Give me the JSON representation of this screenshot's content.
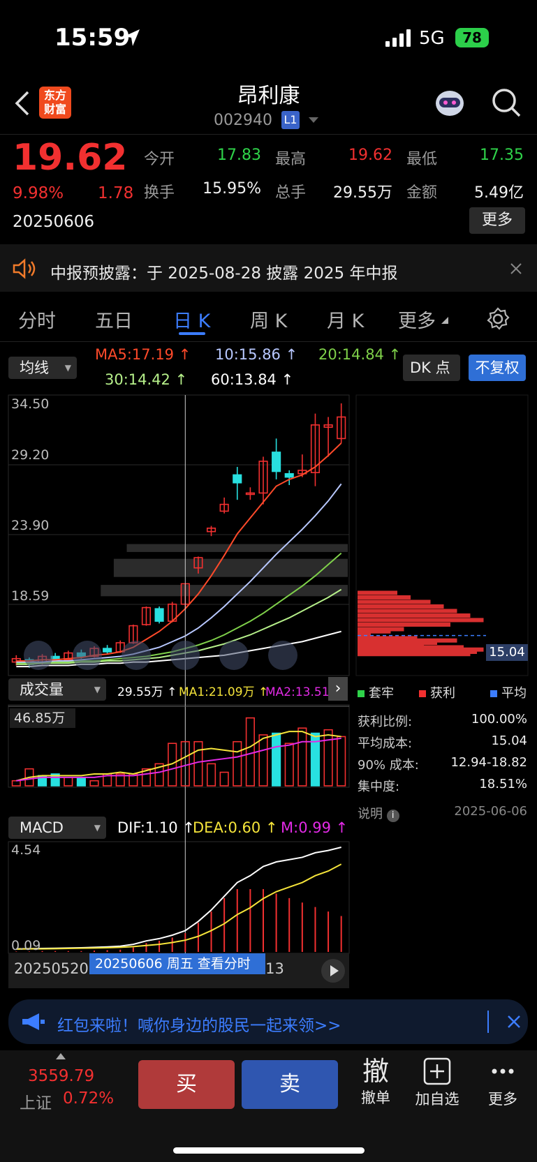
{
  "status_bar": {
    "time": "15:59",
    "network": "5G",
    "battery": "78"
  },
  "header": {
    "title": "昂利康",
    "code": "002940",
    "level_badge": "L1",
    "logo_line1": "东方",
    "logo_line2": "财富"
  },
  "quote": {
    "price": "19.62",
    "change_pct": "9.98%",
    "change": "1.78",
    "date": "20250606",
    "open_label": "今开",
    "open": "17.83",
    "high_label": "最高",
    "high": "19.62",
    "low_label": "最低",
    "low": "17.35",
    "turnover_label": "换手",
    "turnover": "15.95%",
    "volume_label": "总手",
    "volume": "29.55万",
    "amount_label": "金额",
    "amount": "5.49亿",
    "more_label": "更多"
  },
  "notice": {
    "text": "中报预披露：于 2025-08-28 披露 2025 年中报"
  },
  "tabs": [
    "分时",
    "五日",
    "日 K",
    "周 K",
    "月 K",
    "更多"
  ],
  "active_tab": "日 K",
  "kline": {
    "indicator_select": "均线",
    "ma5": "MA5:17.19 ↑",
    "ma10": "10:15.86 ↑",
    "ma20": "20:14.84 ↑",
    "ma30": "30:14.42 ↑",
    "ma60": "60:13.84 ↑",
    "dk_label": "DK 点",
    "fq_label": "不复权",
    "y_ticks": [
      "34.50",
      "29.20",
      "23.90",
      "18.59"
    ]
  },
  "volume_panel": {
    "select": "成交量",
    "vol": "29.55万 ↑",
    "ma1": "MA1:21.09万 ↑",
    "ma2": "MA2:13.51万",
    "max_label": "46.85万"
  },
  "macd_panel": {
    "select": "MACD",
    "dif": "DIF:1.10 ↑",
    "dea": "DEA:0.60 ↑",
    "m": "M:0.99 ↑",
    "y_top": "4.54",
    "y_bottom": "0.09",
    "date_start": "20250520",
    "date_mid": "20250613",
    "crosshair_label": "20250606 周五 查看分时"
  },
  "chip_profile": {
    "current_cost_label": "15.04",
    "legend": [
      "套牢",
      "获利",
      "平均"
    ],
    "profit_ratio_label": "获利比例:",
    "profit_ratio": "100.00%",
    "avg_cost_label": "平均成本:",
    "avg_cost": "15.04",
    "cost90_label": "90% 成本:",
    "cost90": "12.94-18.82",
    "concentration_label": "集中度:",
    "concentration": "18.51%",
    "note_label": "说明",
    "date": "2025-06-06"
  },
  "redpack": {
    "text": "红包来啦！喊你身边的股民一起来领>>"
  },
  "bottom_bar": {
    "index_value": "3559.79",
    "index_name": "上证",
    "index_change": "0.72%",
    "buy": "买",
    "sell": "卖",
    "cancel_icon": "撤",
    "cancel": "撤单",
    "add": "加自选",
    "more": "更多"
  },
  "colors": {
    "up": "#f23030",
    "down": "#2fd34a",
    "accent": "#3c7dff",
    "ma5": "#ff4a2a",
    "ma10": "#b8c8ff",
    "ma20": "#7fd14a",
    "ma30": "#b6f08a",
    "ma60": "#ffffff"
  },
  "chart_data": [
    {
      "type": "candlestick",
      "title": "",
      "ylim": [
        12.0,
        35.5
      ],
      "candles": [
        {
          "o": 12.7,
          "c": 13.0,
          "h": 13.3,
          "l": 12.4
        },
        {
          "o": 12.9,
          "c": 12.5,
          "h": 13.1,
          "l": 12.2
        },
        {
          "o": 12.6,
          "c": 13.2,
          "h": 13.4,
          "l": 12.5
        },
        {
          "o": 13.2,
          "c": 12.9,
          "h": 13.5,
          "l": 12.7
        },
        {
          "o": 12.9,
          "c": 13.5,
          "h": 13.7,
          "l": 12.8
        },
        {
          "o": 13.5,
          "c": 13.2,
          "h": 13.8,
          "l": 13.0
        },
        {
          "o": 13.2,
          "c": 13.9,
          "h": 14.1,
          "l": 13.1
        },
        {
          "o": 13.9,
          "c": 13.6,
          "h": 14.2,
          "l": 13.4
        },
        {
          "o": 13.6,
          "c": 14.4,
          "h": 14.6,
          "l": 13.5
        },
        {
          "o": 14.4,
          "c": 15.9,
          "h": 16.0,
          "l": 14.3
        },
        {
          "o": 16.0,
          "c": 17.5,
          "h": 17.6,
          "l": 15.9
        },
        {
          "o": 17.4,
          "c": 16.3,
          "h": 17.6,
          "l": 16.1
        },
        {
          "o": 16.3,
          "c": 17.8,
          "h": 18.0,
          "l": 16.2
        },
        {
          "o": 17.8,
          "c": 19.6,
          "h": 19.6,
          "l": 17.4
        },
        {
          "o": 21.0,
          "c": 21.9,
          "h": 22.0,
          "l": 20.5
        },
        {
          "o": 24.2,
          "c": 24.5,
          "h": 24.7,
          "l": 23.8
        },
        {
          "o": 26.0,
          "c": 26.6,
          "h": 27.2,
          "l": 25.8
        },
        {
          "o": 29.2,
          "c": 28.5,
          "h": 29.9,
          "l": 27.0
        },
        {
          "o": 27.5,
          "c": 27.6,
          "h": 28.1,
          "l": 27.0
        },
        {
          "o": 27.6,
          "c": 30.4,
          "h": 30.8,
          "l": 26.6
        },
        {
          "o": 31.2,
          "c": 29.5,
          "h": 32.4,
          "l": 28.8
        },
        {
          "o": 29.3,
          "c": 29.0,
          "h": 29.6,
          "l": 28.3
        },
        {
          "o": 29.3,
          "c": 29.6,
          "h": 31.0,
          "l": 29.0
        },
        {
          "o": 29.4,
          "c": 33.6,
          "h": 34.6,
          "l": 28.2
        },
        {
          "o": 33.4,
          "c": 33.6,
          "h": 34.3,
          "l": 30.8
        },
        {
          "o": 32.4,
          "c": 34.3,
          "h": 35.5,
          "l": 32.0
        }
      ],
      "ma5": [
        12.8,
        12.8,
        12.9,
        12.9,
        13.0,
        13.1,
        13.3,
        13.4,
        13.6,
        14.0,
        14.7,
        15.4,
        16.3,
        17.4,
        18.7,
        20.3,
        22.1,
        24.0,
        25.4,
        26.8,
        28.2,
        28.8,
        29.2,
        29.9,
        30.9,
        32.0
      ],
      "ma10": [
        12.7,
        12.7,
        12.7,
        12.8,
        12.8,
        12.9,
        13.0,
        13.1,
        13.2,
        13.4,
        13.7,
        14.0,
        14.5,
        15.0,
        15.7,
        16.6,
        17.6,
        18.7,
        19.8,
        21.0,
        22.2,
        23.3,
        24.4,
        25.6,
        26.9,
        28.4
      ],
      "ma20": [
        12.6,
        12.6,
        12.7,
        12.7,
        12.7,
        12.8,
        12.8,
        12.9,
        13.0,
        13.1,
        13.2,
        13.4,
        13.6,
        13.9,
        14.2,
        14.6,
        15.1,
        15.7,
        16.3,
        17.0,
        17.8,
        18.6,
        19.4,
        20.3,
        21.3,
        22.3
      ],
      "ma30": [
        12.5,
        12.5,
        12.6,
        12.6,
        12.6,
        12.7,
        12.7,
        12.8,
        12.8,
        12.9,
        13.0,
        13.1,
        13.3,
        13.5,
        13.7,
        14.0,
        14.3,
        14.7,
        15.1,
        15.6,
        16.1,
        16.6,
        17.2,
        17.8,
        18.4,
        19.1
      ],
      "ma60": [
        12.3,
        12.3,
        12.4,
        12.4,
        12.4,
        12.5,
        12.5,
        12.6,
        12.6,
        12.7,
        12.7,
        12.8,
        12.9,
        13.0,
        13.1,
        13.2,
        13.3,
        13.5,
        13.7,
        13.9,
        14.1,
        14.3,
        14.5,
        14.8,
        15.1,
        15.4
      ]
    },
    {
      "type": "bar",
      "title": "成交量",
      "ylim": [
        0,
        46.85
      ],
      "values": [
        3,
        10,
        6,
        7,
        5,
        5,
        3,
        7,
        7,
        7,
        10,
        13,
        25,
        26,
        26,
        13,
        8,
        26,
        40,
        30,
        31,
        25,
        34,
        31,
        33,
        29
      ],
      "up": [
        true,
        true,
        false,
        false,
        true,
        false,
        true,
        true,
        true,
        true,
        true,
        true,
        true,
        true,
        true,
        true,
        true,
        true,
        true,
        true,
        false,
        true,
        true,
        false,
        true,
        true
      ],
      "ma1": [
        3,
        5,
        6,
        6,
        6,
        6,
        7,
        7,
        8,
        7,
        9,
        11,
        13,
        17,
        21,
        22,
        21,
        20,
        23,
        28,
        30,
        32,
        32,
        29,
        30,
        29
      ],
      "ma2": [
        3,
        4,
        5,
        5,
        5,
        5,
        5,
        6,
        6,
        6,
        7,
        8,
        10,
        12,
        14,
        15,
        16,
        17,
        19,
        21,
        23,
        24,
        26,
        26,
        27,
        28
      ]
    },
    {
      "type": "line",
      "title": "MACD",
      "ylim": [
        0.09,
        4.54
      ],
      "dif": [
        0.1,
        0.11,
        0.12,
        0.13,
        0.14,
        0.15,
        0.17,
        0.19,
        0.22,
        0.3,
        0.45,
        0.55,
        0.7,
        0.9,
        1.3,
        1.8,
        2.4,
        3.0,
        3.3,
        3.7,
        3.9,
        4.0,
        4.1,
        4.3,
        4.4,
        4.54
      ],
      "dea": [
        0.09,
        0.1,
        0.1,
        0.11,
        0.12,
        0.13,
        0.14,
        0.15,
        0.17,
        0.2,
        0.25,
        0.3,
        0.38,
        0.48,
        0.65,
        0.9,
        1.2,
        1.6,
        1.9,
        2.3,
        2.6,
        2.8,
        3.0,
        3.3,
        3.5,
        3.8
      ],
      "m": [
        0.02,
        0.02,
        0.04,
        0.04,
        0.04,
        0.04,
        0.06,
        0.08,
        0.1,
        0.2,
        0.4,
        0.5,
        0.64,
        0.84,
        1.3,
        1.8,
        2.4,
        2.8,
        2.8,
        2.8,
        2.6,
        2.4,
        2.2,
        2.0,
        1.8,
        1.6
      ]
    }
  ]
}
